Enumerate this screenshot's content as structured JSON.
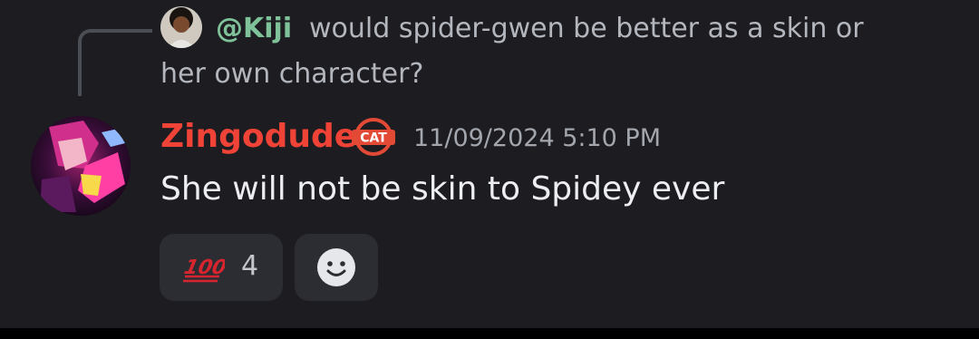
{
  "reply": {
    "username": "@Kiji",
    "text_line1": "would spider-gwen be better as a skin or",
    "text_line2": "her own character?"
  },
  "message": {
    "author": "Zingodude",
    "badge_text": "CAT",
    "timestamp": "11/09/2024 5:10 PM",
    "text": "She will not be skin to Spidey ever"
  },
  "reactions": [
    {
      "emoji_icon": "hundred-points-icon",
      "glyph": "100",
      "count": "4"
    }
  ],
  "add_reaction": {
    "icon": "smiley-face-icon"
  },
  "colors": {
    "background": "#1c1c21",
    "reply_username": "#7fc29a",
    "author_name": "#ee4336",
    "reaction_bg": "#2b2d33",
    "hundred_red": "#d6252f"
  }
}
